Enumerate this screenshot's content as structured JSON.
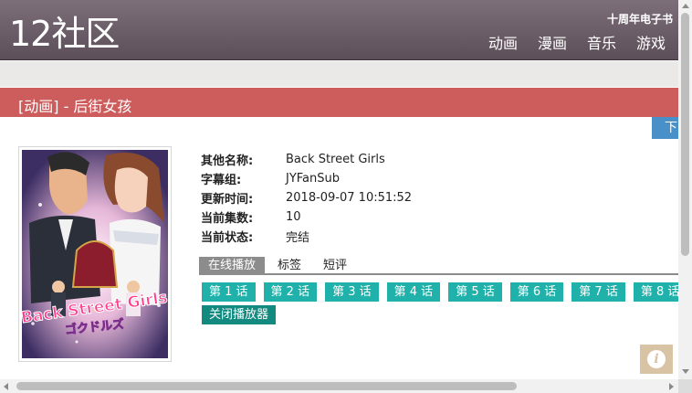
{
  "header": {
    "logo": "12社区",
    "top_link": "十周年电子书",
    "nav": [
      {
        "label": "动画"
      },
      {
        "label": "漫画"
      },
      {
        "label": "音乐"
      },
      {
        "label": "游戏"
      }
    ]
  },
  "page": {
    "title": "[动画] - 后街女孩",
    "download_label": "下"
  },
  "poster": {
    "alt": "Back Street Girls",
    "overlay_title": "Back Street Girls",
    "overlay_subtitle": "ゴクドルズ"
  },
  "info": [
    {
      "label": "其他名称:",
      "value": "Back Street Girls"
    },
    {
      "label": "字幕组:",
      "value": "JYFanSub"
    },
    {
      "label": "更新时间:",
      "value": "2018-09-07 10:51:52"
    },
    {
      "label": "当前集数:",
      "value": "10"
    },
    {
      "label": "当前状态:",
      "value": "完结"
    }
  ],
  "tabs": [
    {
      "label": "在线播放",
      "active": true
    },
    {
      "label": "标签",
      "active": false
    },
    {
      "label": "短评",
      "active": false
    }
  ],
  "episodes": [
    {
      "label": "第 1 话"
    },
    {
      "label": "第 2 话"
    },
    {
      "label": "第 3 话"
    },
    {
      "label": "第 4 话"
    },
    {
      "label": "第 5 话"
    },
    {
      "label": "第 6 话"
    },
    {
      "label": "第 7 话"
    },
    {
      "label": "第 8 话"
    }
  ],
  "close_player_label": "关闭播放器",
  "info_fab_glyph": "i",
  "colors": {
    "header": "#6b5d67",
    "title_bar": "#cd5c5c",
    "episode_button": "#20b2aa",
    "close_button": "#138a80",
    "download_button": "#4a90c8"
  }
}
